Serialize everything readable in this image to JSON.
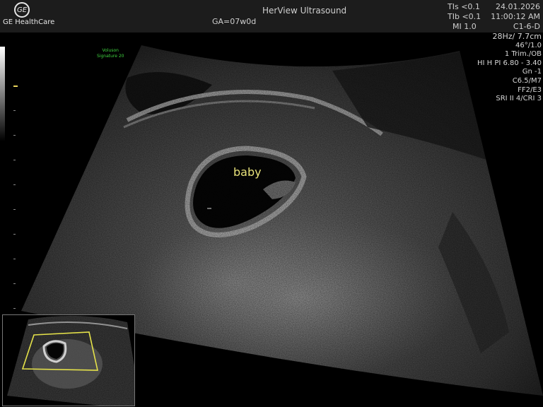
{
  "brand": {
    "logo_text": "GE",
    "name": "GE HealthCare"
  },
  "app": {
    "title": "HerView Ultrasound"
  },
  "exam": {
    "ga": "GA=07w0d",
    "annotation": "baby"
  },
  "metrics": {
    "tis": "TIs <0.1",
    "tib": "TIb <0.1",
    "mi": "MI  1.0"
  },
  "datetime": {
    "date": "24.01.2026",
    "time": "11:00:12 AM",
    "probe": "C1-6-D"
  },
  "params": [
    "28Hz/ 7.7cm",
    "46°/1.0",
    "1 Trim./OB",
    "HI H PI 6.80 - 3.40",
    "Gn  -1",
    "C6.5/M7",
    "FF2/E3",
    "SRI II 4/CRI 3"
  ],
  "system": {
    "line1": "Voluson",
    "line2": "Signature 20"
  },
  "colors": {
    "annotation": "#e8e27a",
    "system_label": "#3fd13f",
    "roi_box": "#e5e24a",
    "depth_marker": "#e8d35a"
  }
}
